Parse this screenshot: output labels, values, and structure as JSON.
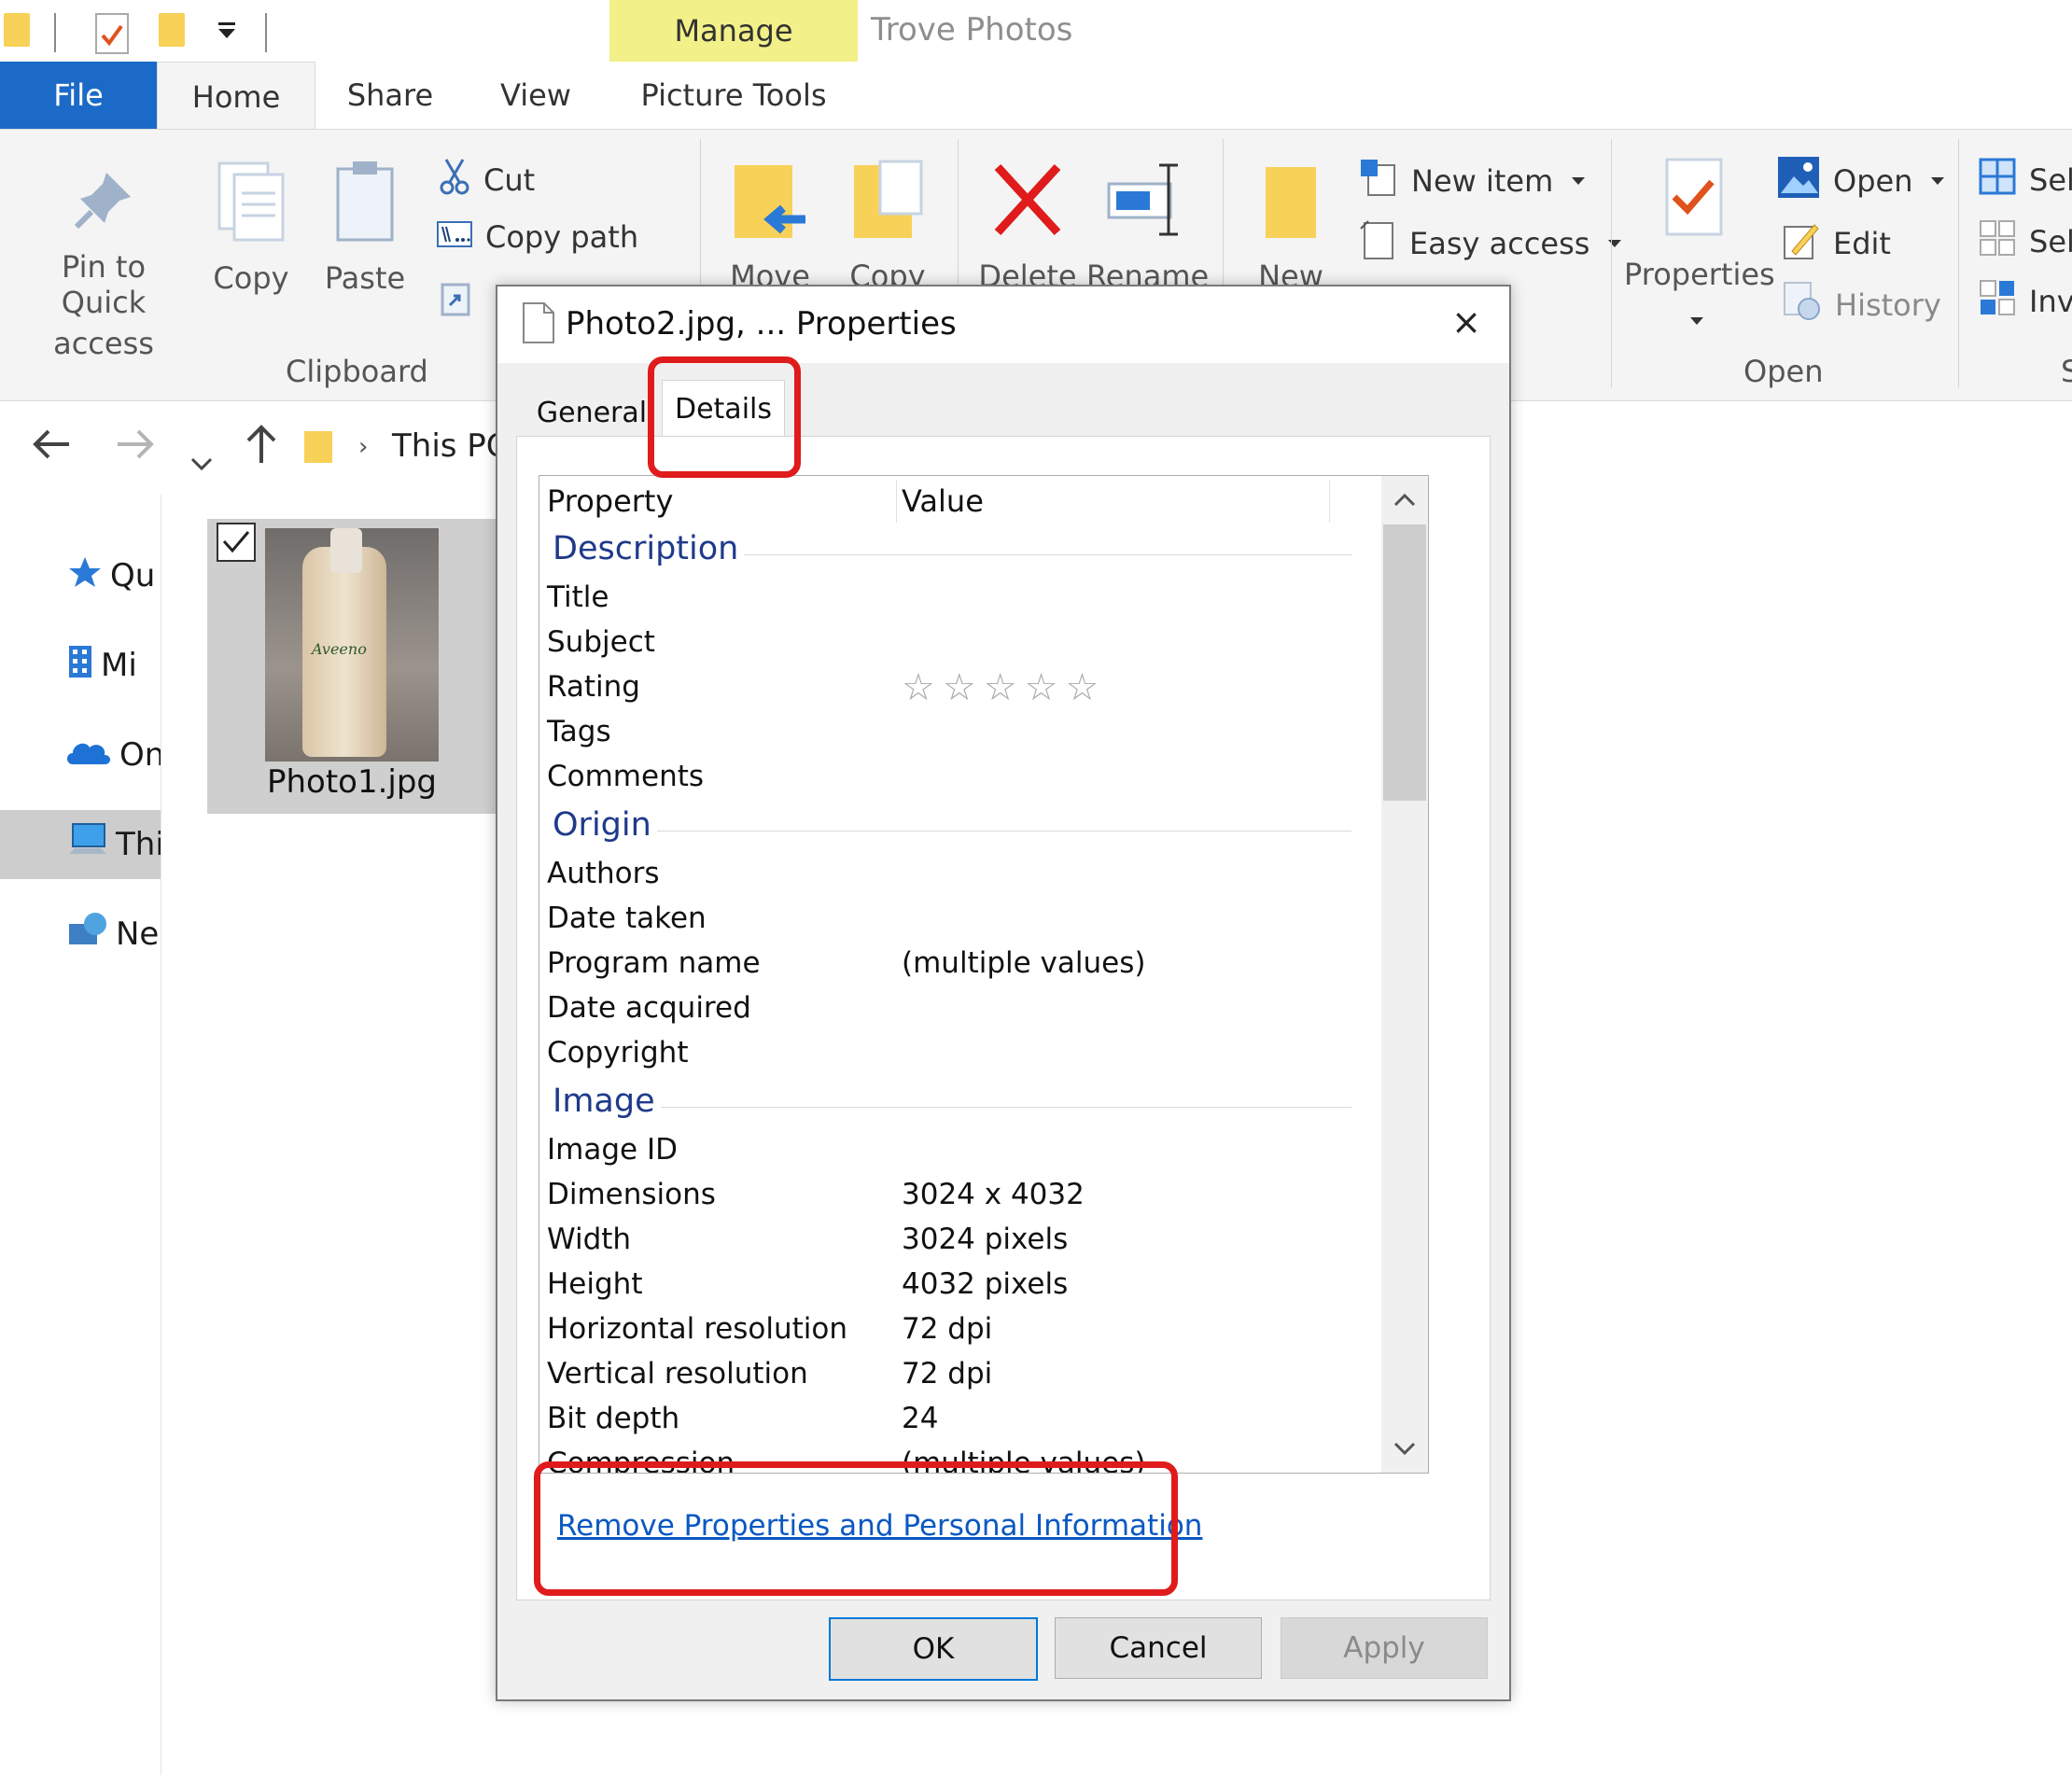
{
  "window": {
    "context_tab": "Manage",
    "app_title": "Trove Photos"
  },
  "tabs": [
    {
      "label": "File"
    },
    {
      "label": "Home"
    },
    {
      "label": "Share"
    },
    {
      "label": "View"
    },
    {
      "label": "Picture Tools"
    }
  ],
  "ribbon": {
    "pin_line1": "Pin to Quick",
    "pin_line2": "access",
    "copy": "Copy",
    "paste": "Paste",
    "cut": "Cut",
    "copy_path": "Copy path",
    "clipboard_group": "Clipboard",
    "move": "Move",
    "copy_to": "Copy",
    "delete": "Delete",
    "rename": "Rename",
    "new_folder": "New",
    "new_item": "New item",
    "easy_access": "Easy access",
    "properties": "Properties",
    "open": "Open",
    "edit": "Edit",
    "history": "History",
    "open_group": "Open",
    "select_all": "Sele",
    "select_none": "Sele",
    "invert": "Inve",
    "select_group": "S"
  },
  "address": {
    "location": "This PC"
  },
  "nav": {
    "items": [
      {
        "label": "Qu"
      },
      {
        "label": "Mi"
      },
      {
        "label": "On"
      },
      {
        "label": "Thi"
      },
      {
        "label": "Ne"
      }
    ]
  },
  "file": {
    "name": "Photo1.jpg",
    "thumb_label": "Aveeno"
  },
  "dialog": {
    "title": "Photo2.jpg, ... Properties",
    "close": "×",
    "tab_general": "General",
    "tab_details": "Details",
    "col_property": "Property",
    "col_value": "Value",
    "sections": {
      "description": "Description",
      "origin": "Origin",
      "image": "Image"
    },
    "rows": {
      "title": {
        "k": "Title",
        "v": ""
      },
      "subject": {
        "k": "Subject",
        "v": ""
      },
      "rating": {
        "k": "Rating",
        "v": "",
        "stars": "☆☆☆☆☆"
      },
      "tags": {
        "k": "Tags",
        "v": ""
      },
      "comments": {
        "k": "Comments",
        "v": ""
      },
      "authors": {
        "k": "Authors",
        "v": ""
      },
      "date_taken": {
        "k": "Date taken",
        "v": ""
      },
      "program_name": {
        "k": "Program name",
        "v": "(multiple values)"
      },
      "date_acquired": {
        "k": "Date acquired",
        "v": ""
      },
      "copyright": {
        "k": "Copyright",
        "v": ""
      },
      "image_id": {
        "k": "Image ID",
        "v": ""
      },
      "dimensions": {
        "k": "Dimensions",
        "v": "3024 x 4032"
      },
      "width": {
        "k": "Width",
        "v": "3024 pixels"
      },
      "height": {
        "k": "Height",
        "v": "4032 pixels"
      },
      "hres": {
        "k": "Horizontal resolution",
        "v": "72 dpi"
      },
      "vres": {
        "k": "Vertical resolution",
        "v": "72 dpi"
      },
      "bit_depth": {
        "k": "Bit depth",
        "v": "24"
      },
      "compression": {
        "k": "Compression",
        "v": "(multiple values)"
      }
    },
    "remove_link": "Remove Properties and Personal Information",
    "ok": "OK",
    "cancel": "Cancel",
    "apply": "Apply"
  },
  "colors": {
    "file_tab": "#1b6ac7",
    "manage_tab": "#f2f088",
    "section_heading": "#1e3a8a",
    "link": "#0a58c2",
    "annotation_red": "#e01b1b"
  }
}
